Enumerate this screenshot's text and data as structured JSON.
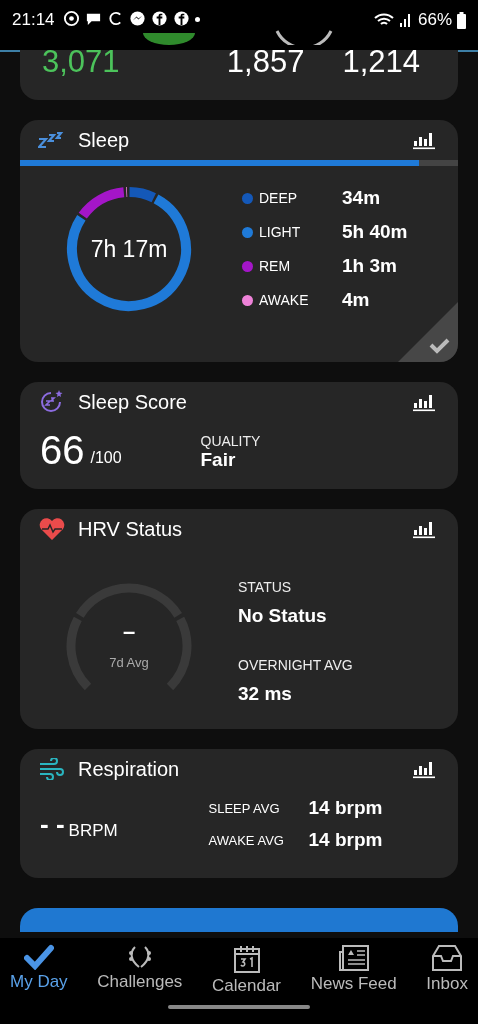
{
  "status_bar": {
    "time": "21:14",
    "battery": "66%"
  },
  "top_card": {
    "values": [
      {
        "text": "3,071",
        "kind": "steps"
      },
      {
        "text": "1,857",
        "kind": "plain"
      },
      {
        "text": "1,214",
        "kind": "plain"
      }
    ]
  },
  "sleep": {
    "title": "Sleep",
    "progress": {
      "level": 0.91
    },
    "total": "7h 17m",
    "stages": [
      {
        "label": "DEEP",
        "value": "34m",
        "color": "#1458b8"
      },
      {
        "label": "LIGHT",
        "value": "5h 40m",
        "color": "#1f7ad8"
      },
      {
        "label": "REM",
        "value": "1h 3m",
        "color": "#a416c8"
      },
      {
        "label": "AWAKE",
        "value": "4m",
        "color": "#ee82d8"
      }
    ]
  },
  "sleep_score": {
    "title": "Sleep Score",
    "score": "66",
    "max": "/100",
    "quality_label": "QUALITY",
    "quality": "Fair"
  },
  "hrv": {
    "title": "HRV Status",
    "gauge_value": "–",
    "gauge_label": "7d Avg",
    "status_label": "STATUS",
    "status": "No Status",
    "overnight_label": "OVERNIGHT AVG",
    "overnight": "32 ms"
  },
  "respiration": {
    "title": "Respiration",
    "value": "- -",
    "unit": "BRPM",
    "rows": [
      {
        "label": "SLEEP AVG",
        "value": "14 brpm"
      },
      {
        "label": "AWAKE AVG",
        "value": "14 brpm"
      }
    ]
  },
  "nav": [
    {
      "label": "My Day",
      "selected": true
    },
    {
      "label": "Challenges",
      "selected": false
    },
    {
      "label": "Calendar",
      "selected": false
    },
    {
      "label": "News Feed",
      "selected": false
    },
    {
      "label": "Inbox",
      "selected": false
    }
  ]
}
